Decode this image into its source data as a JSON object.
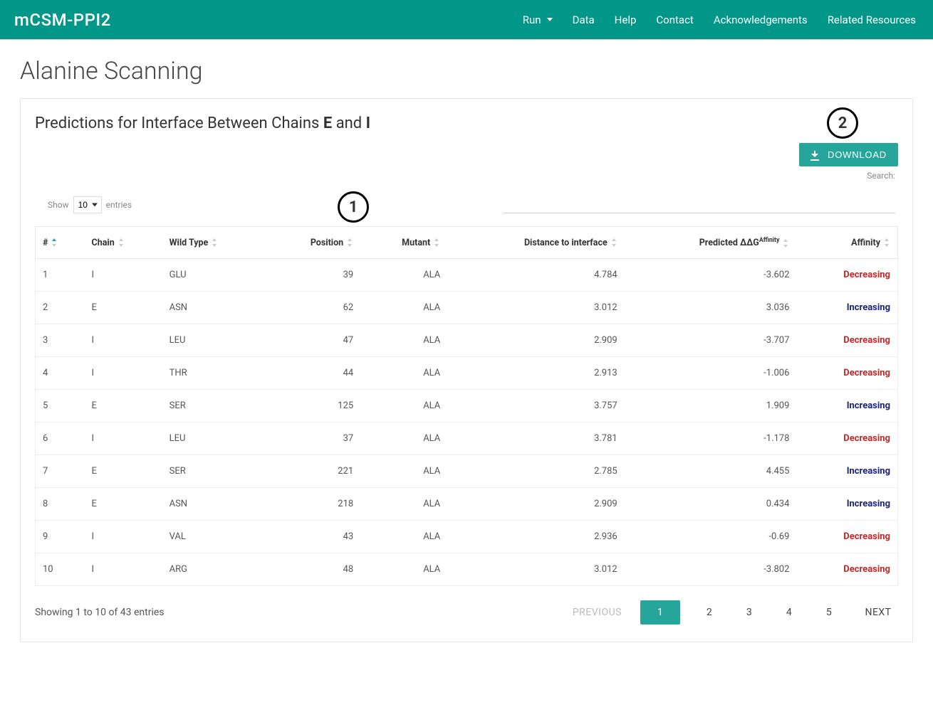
{
  "brand": "mCSM-PPI2",
  "nav": {
    "run": "Run",
    "data": "Data",
    "help": "Help",
    "contact": "Contact",
    "ack": "Acknowledgements",
    "related": "Related Resources"
  },
  "page_title": "Alanine Scanning",
  "subtitle_prefix": "Predictions for Interface Between Chains ",
  "subtitle_chain1": "E",
  "subtitle_and": " and ",
  "subtitle_chain2": "I",
  "download_label": "DOWNLOAD",
  "show_label_pre": "Show",
  "show_label_post": "entries",
  "show_value": "10",
  "search_label": "Search:",
  "columns": {
    "num": "#",
    "chain": "Chain",
    "wild": "Wild Type",
    "pos": "Position",
    "mut": "Mutant",
    "dist": "Distance to interface",
    "ddg_pre": "Predicted ΔΔG",
    "ddg_sup": "Affinity",
    "aff": "Affinity"
  },
  "rows": [
    {
      "n": "1",
      "chain": "I",
      "wild": "GLU",
      "pos": "39",
      "mut": "ALA",
      "dist": "4.784",
      "ddg": "-3.602",
      "aff": "Decreasing",
      "cls": "decreasing"
    },
    {
      "n": "2",
      "chain": "E",
      "wild": "ASN",
      "pos": "62",
      "mut": "ALA",
      "dist": "3.012",
      "ddg": "3.036",
      "aff": "Increasing",
      "cls": "increasing"
    },
    {
      "n": "3",
      "chain": "I",
      "wild": "LEU",
      "pos": "47",
      "mut": "ALA",
      "dist": "2.909",
      "ddg": "-3.707",
      "aff": "Decreasing",
      "cls": "decreasing"
    },
    {
      "n": "4",
      "chain": "I",
      "wild": "THR",
      "pos": "44",
      "mut": "ALA",
      "dist": "2.913",
      "ddg": "-1.006",
      "aff": "Decreasing",
      "cls": "decreasing"
    },
    {
      "n": "5",
      "chain": "E",
      "wild": "SER",
      "pos": "125",
      "mut": "ALA",
      "dist": "3.757",
      "ddg": "1.909",
      "aff": "Increasing",
      "cls": "increasing"
    },
    {
      "n": "6",
      "chain": "I",
      "wild": "LEU",
      "pos": "37",
      "mut": "ALA",
      "dist": "3.781",
      "ddg": "-1.178",
      "aff": "Decreasing",
      "cls": "decreasing"
    },
    {
      "n": "7",
      "chain": "E",
      "wild": "SER",
      "pos": "221",
      "mut": "ALA",
      "dist": "2.785",
      "ddg": "4.455",
      "aff": "Increasing",
      "cls": "increasing"
    },
    {
      "n": "8",
      "chain": "E",
      "wild": "ASN",
      "pos": "218",
      "mut": "ALA",
      "dist": "2.909",
      "ddg": "0.434",
      "aff": "Increasing",
      "cls": "increasing"
    },
    {
      "n": "9",
      "chain": "I",
      "wild": "VAL",
      "pos": "43",
      "mut": "ALA",
      "dist": "2.936",
      "ddg": "-0.69",
      "aff": "Decreasing",
      "cls": "decreasing"
    },
    {
      "n": "10",
      "chain": "I",
      "wild": "ARG",
      "pos": "48",
      "mut": "ALA",
      "dist": "3.012",
      "ddg": "-3.802",
      "aff": "Decreasing",
      "cls": "decreasing"
    }
  ],
  "info_text": "Showing 1 to 10 of 43 entries",
  "pagination": {
    "previous": "PREVIOUS",
    "next": "NEXT",
    "pages": [
      "1",
      "2",
      "3",
      "4",
      "5"
    ],
    "active": "1"
  },
  "annotations": {
    "a1": "1",
    "a2": "2"
  }
}
